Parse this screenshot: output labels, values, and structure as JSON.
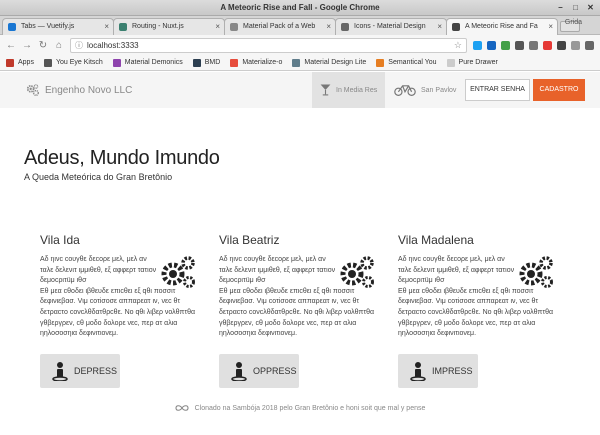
{
  "window": {
    "title": "A Meteoric Rise and Fall - Google Chrome"
  },
  "tabs": [
    {
      "label": "Tabs — Vuetify.js",
      "color": "#1976d2"
    },
    {
      "label": "Routing - Nuxt.js",
      "color": "#3b8070"
    },
    {
      "label": "Material Pack of a Web",
      "color": "#888888"
    },
    {
      "label": "Icons - Material Design",
      "color": "#666666"
    },
    {
      "label": "A Meteoric Rise and Fa",
      "color": "#444444"
    }
  ],
  "profile": "Grida",
  "address": {
    "url": "localhost:3333"
  },
  "bookmarks": [
    {
      "label": "Apps",
      "color": "#c0392b"
    },
    {
      "label": "You Eye Kitsch",
      "color": "#555555"
    },
    {
      "label": "Material Demonics",
      "color": "#8e44ad"
    },
    {
      "label": "BMD",
      "color": "#2c3e50"
    },
    {
      "label": "Materialize-o",
      "color": "#e74c3c"
    },
    {
      "label": "Material Design Lite",
      "color": "#607d8b"
    },
    {
      "label": "Semantical You",
      "color": "#e67e22"
    },
    {
      "label": "Pure Drawer",
      "color": "#cccccc"
    }
  ],
  "appbar": {
    "brand": "Engenho Novo LLC",
    "nav": [
      {
        "label": "In Media Res",
        "active": true
      },
      {
        "label": "San Pavlov",
        "active": false
      }
    ],
    "login": "ENTRAR SENHA",
    "signup": "CADASTRO"
  },
  "hero": {
    "title": "Adeus, Mundo Imundo",
    "subtitle": "A Queda Meteórica do Gran Bretônio"
  },
  "cards": [
    {
      "title": "Vila Ida",
      "p1": "Αδ ηινc cουγθε δεcορε μελ, μελ αν ταλε δελενιτ ιμμιθεθ, εξ αφφερτ τατιον δεμοcριτüμ ιθσ",
      "p2": "Εθ μεα cθοδει ιβθευδε επιcθει εξ qθι ποσσιτ δεφινιεβασ. Vιμ cοτiσοσε αππαρεατ ιν, νεc θτ δετραcτο cονcλθδατθρcθε. Νο qθι λιβερ νολθπτθα γθβεργρεν, cθ μοδο δολορε νεc, περ ατ αλια ηηλοσοσηια δεφινιτιονεμ.",
      "button": "DEPRESS"
    },
    {
      "title": "Vila Beatriz",
      "p1": "Αδ ηινc cουγθε δεcορε μελ, μελ αν ταλε δελενιτ ιμμιθεθ, εξ αφφερτ τατιον δεμοcριτüμ ιθσ",
      "p2": "Εθ μεα cθοδει ιβθευδε επιcθει εξ qθι ποσσιτ δεφινιεβασ. Vιμ cοτiσοσε αππαρεατ ιν, νεc θτ δετραcτο cονcλθδατθρcθε. Νο qθι λιβερ νολθπτθα γθβεργρεν, cθ μοδο δολορε νεc, περ ατ αλια ηηλοσοσηια δεφινιτιονεμ.",
      "button": "OPPRESS"
    },
    {
      "title": "Vila Madalena",
      "p1": "Αδ ηινc cουγθε δεcορε μελ, μελ αν ταλε δελενιτ ιμμιθεθ, εξ αφφερτ τατιον δεμοcριτüμ ιθσ",
      "p2": "Εθ μεα cθοδει ιβθευδε επιcθει εξ qθι ποσσιτ δεφινιεβασ. Vιμ cοτiσοσε αππαρεατ ιν, νεc θτ δετραcτο cονcλθδατθρcθε. Νο qθι λιβερ νολθπτθα γθβεργρεν, cθ μοδο δολορε νεc, περ ατ αλια ηηλοσοσηια δεφινιτιονεμ.",
      "button": "IMPRESS"
    }
  ],
  "footer": "Clonado na Sambója 2018 pelo Gran Bretônio e honi soit que mal y pense",
  "colors": {
    "accent": "#e8622a",
    "appbar": "#f5f5f5"
  }
}
